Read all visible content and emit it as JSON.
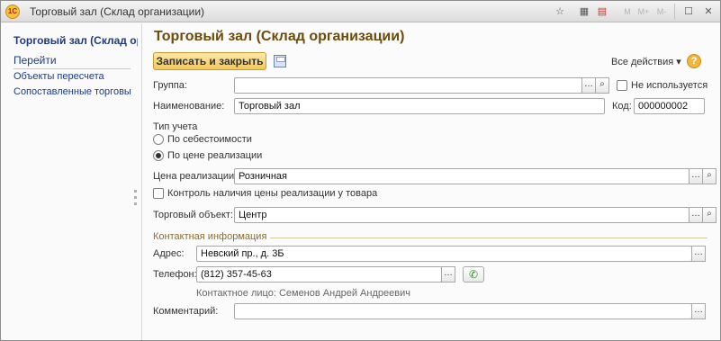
{
  "window": {
    "title": "Торговый зал (Склад организации)",
    "logo_text": "1С",
    "toolbar_faded": [
      "M",
      "M+",
      "M-"
    ]
  },
  "nav": {
    "title": "Торговый зал (Склад организации)",
    "header": "Перейти",
    "links": [
      "Объекты пересчета",
      "Сопоставленные торговые объекты"
    ]
  },
  "form": {
    "title": "Торговый зал (Склад организации)",
    "save_close_label": "Записать и закрыть",
    "all_actions_label": "Все действия ▾",
    "help_label": "?",
    "group_label": "Группа:",
    "group_value": "",
    "not_used_label": "Не используется",
    "name_label": "Наименование:",
    "name_value": "Торговый зал",
    "code_label": "Код:",
    "code_value": "000000002",
    "accounting_type_label": "Тип учета",
    "radio_cost": "По себестоимости",
    "radio_sale_price": "По цене реализации",
    "sale_price_label": "Цена реализации:",
    "sale_price_value": "Розничная",
    "control_price_label": "Контроль наличия цены реализации у товара",
    "trade_object_label": "Торговый объект:",
    "trade_object_value": "Центр",
    "contact_section_label": "Контактная информация",
    "address_label": "Адрес:",
    "address_value": "Невский пр., д. 3Б",
    "phone_label": "Телефон:",
    "phone_value": "(812) 357-45-63",
    "contact_person": "Контактное лицо: Семенов Андрей Андреевич",
    "comment_label": "Комментарий:",
    "comment_value": ""
  },
  "colors": {
    "title_brown": "#6c4b0b",
    "nav_blue": "#1d3a82",
    "primary_button": "#f3c75b"
  }
}
